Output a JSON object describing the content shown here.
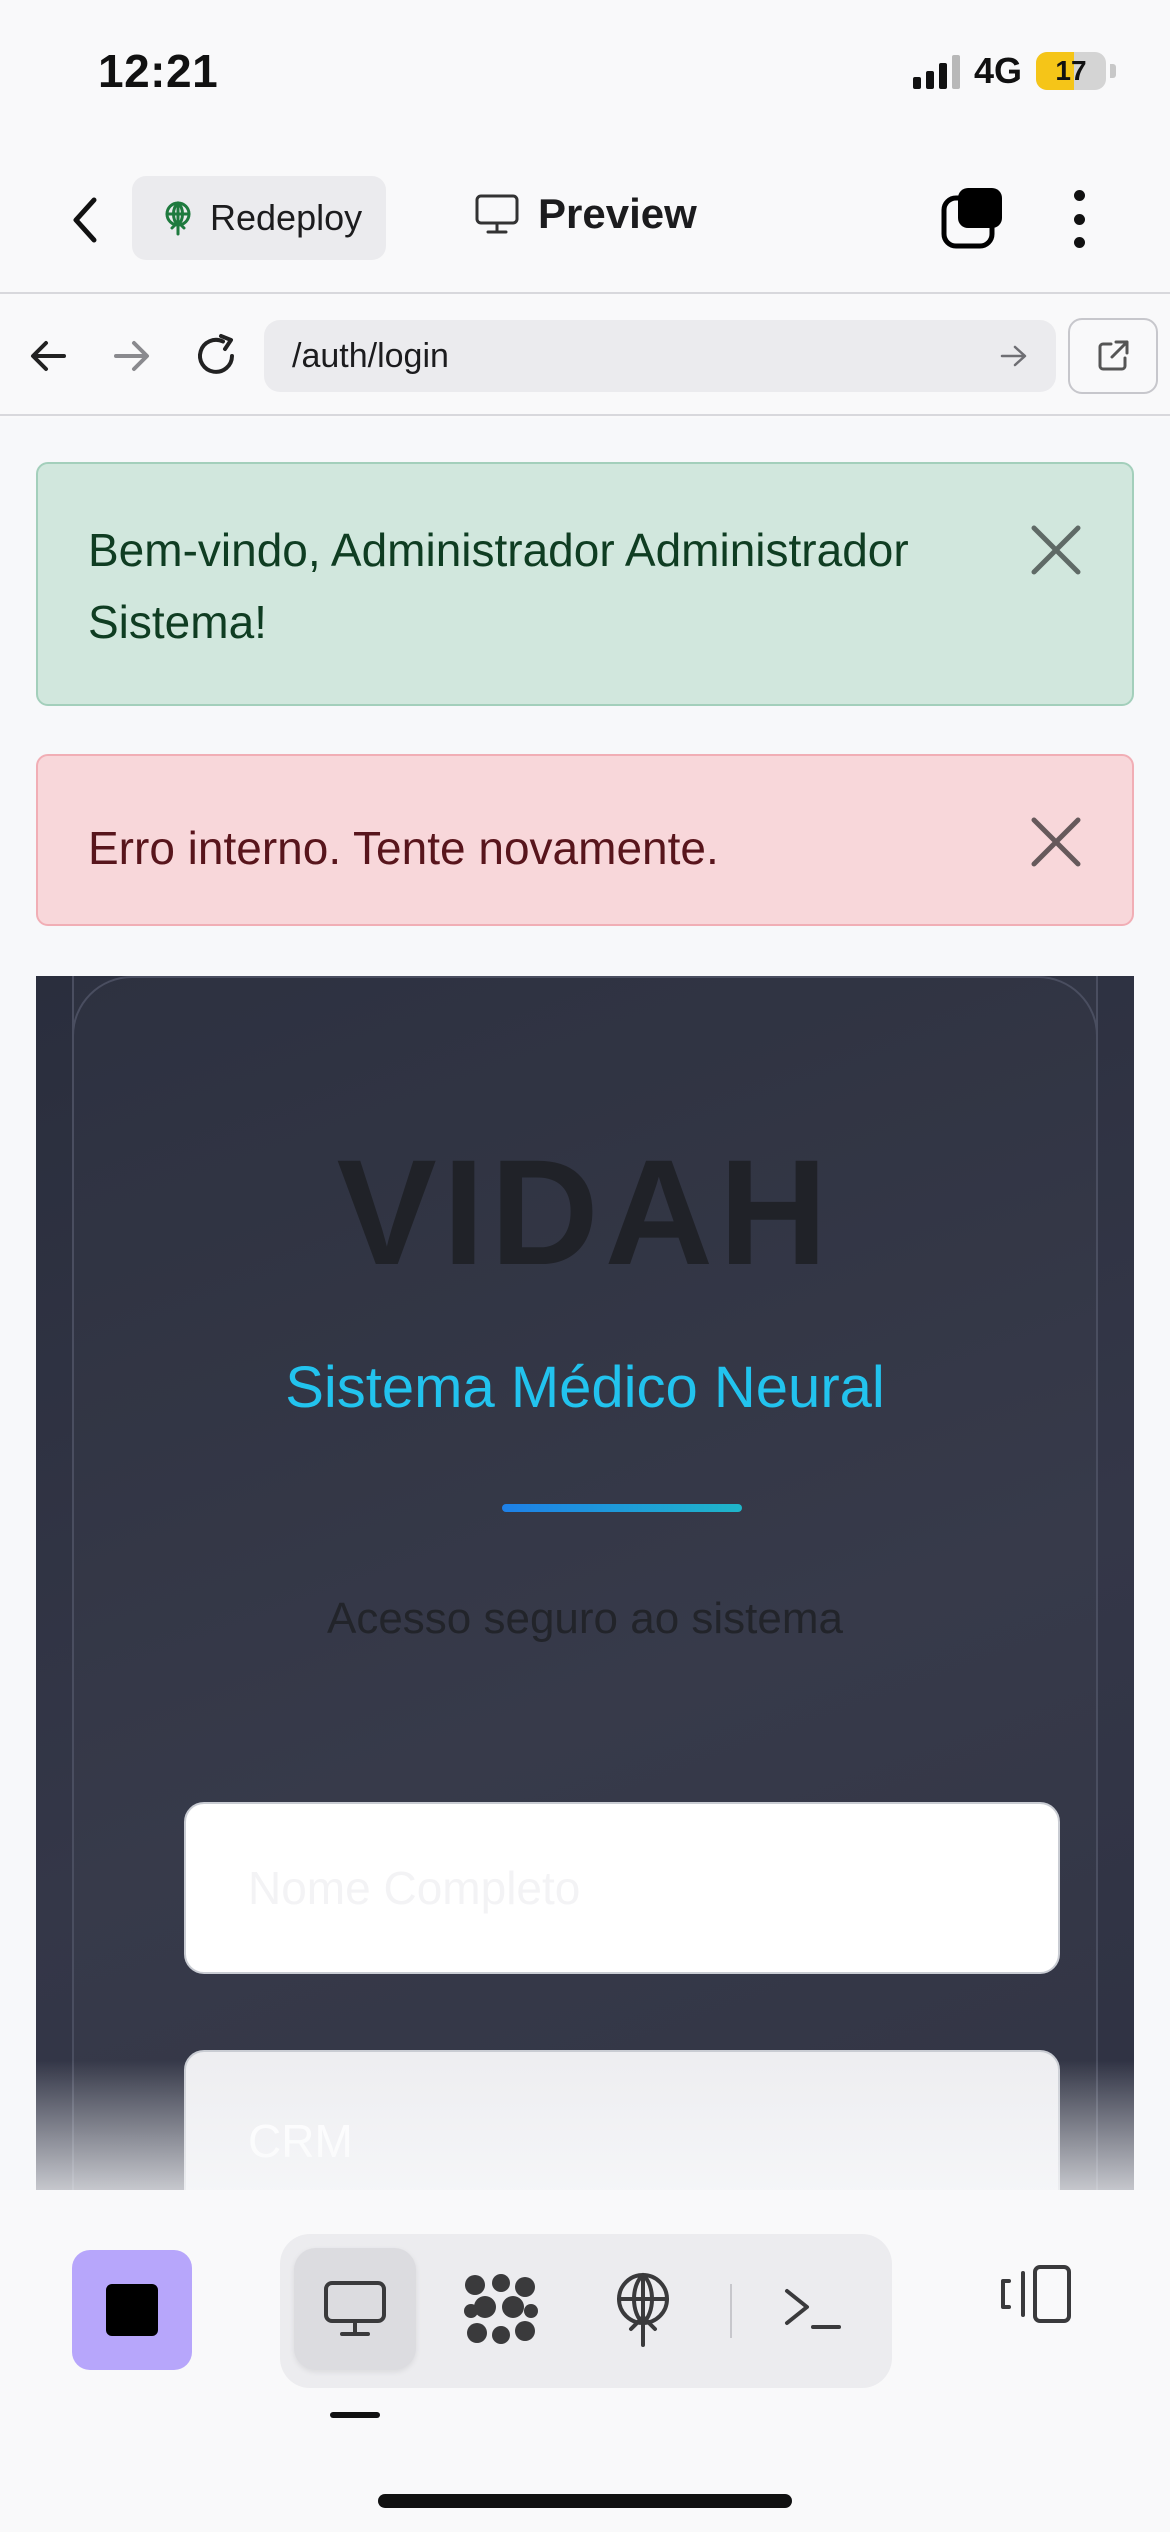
{
  "status_bar": {
    "time": "12:21",
    "network": "4G",
    "battery": "17",
    "battery_level_percent": 17,
    "signal_bars_active": 3,
    "signal_bars_total": 4
  },
  "header": {
    "redeploy_label": "Redeploy",
    "preview_label": "Preview",
    "icons": {
      "back": "chevron-left-icon",
      "redeploy": "deploy-icon",
      "preview": "monitor-icon",
      "tabs": "tabs-icon",
      "more": "more-vertical-icon"
    }
  },
  "url_bar": {
    "url": "/auth/login",
    "icons": {
      "back": "arrow-left-icon",
      "forward": "arrow-right-icon",
      "reload": "reload-icon",
      "go": "arrow-right-small-icon",
      "external": "external-link-icon"
    }
  },
  "alerts": {
    "success_text": "Bem-vindo, Administrador Administrador Sistema!",
    "danger_text": "Erro interno. Tente novamente."
  },
  "login": {
    "brand": "VIDAH",
    "subtitle": "Sistema Médico Neural",
    "tagline": "Acesso seguro ao sistema",
    "name_placeholder": "Nome Completo",
    "crm_placeholder": "CRM"
  },
  "toolbar": {
    "icons": [
      "stop-icon",
      "monitor-icon",
      "modules-icon",
      "deploy-icon",
      "terminal-icon",
      "panel-toggle-icon"
    ],
    "active_tool": "monitor-icon"
  },
  "colors": {
    "accent_purple": "#b7a6fb",
    "success_bg": "#d1e7dd",
    "danger_bg": "#f8d7da",
    "subtitle_cyan": "#22c3ee",
    "panel_dark": "#2f3243",
    "battery_yellow": "#f5c518"
  }
}
